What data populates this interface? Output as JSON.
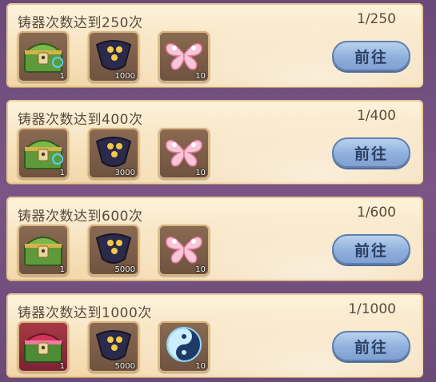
{
  "tasks": [
    {
      "title": "铸器次数达到250次",
      "progress": "1/250",
      "button": "前往",
      "rewards": [
        {
          "icon": "green-chest-icon",
          "qty": "1"
        },
        {
          "icon": "dark-stone-icon",
          "qty": "1000"
        },
        {
          "icon": "pink-butterfly-icon",
          "qty": "10"
        }
      ]
    },
    {
      "title": "铸器次数达到400次",
      "progress": "1/400",
      "button": "前往",
      "rewards": [
        {
          "icon": "green-chest-icon",
          "qty": "1"
        },
        {
          "icon": "dark-stone-icon",
          "qty": "3000"
        },
        {
          "icon": "pink-butterfly-icon",
          "qty": "10"
        }
      ]
    },
    {
      "title": "铸器次数达到600次",
      "progress": "1/600",
      "button": "前往",
      "rewards": [
        {
          "icon": "green-chest-icon",
          "qty": "1"
        },
        {
          "icon": "dark-stone-icon",
          "qty": "5000"
        },
        {
          "icon": "pink-butterfly-icon",
          "qty": "10"
        }
      ]
    },
    {
      "title": "铸器次数达到1000次",
      "progress": "1/1000",
      "button": "前往",
      "rewards": [
        {
          "icon": "red-chest-icon",
          "qty": "1"
        },
        {
          "icon": "dark-stone-icon",
          "qty": "5000"
        },
        {
          "icon": "blue-swirl-orb-icon",
          "qty": "10"
        }
      ]
    }
  ]
}
